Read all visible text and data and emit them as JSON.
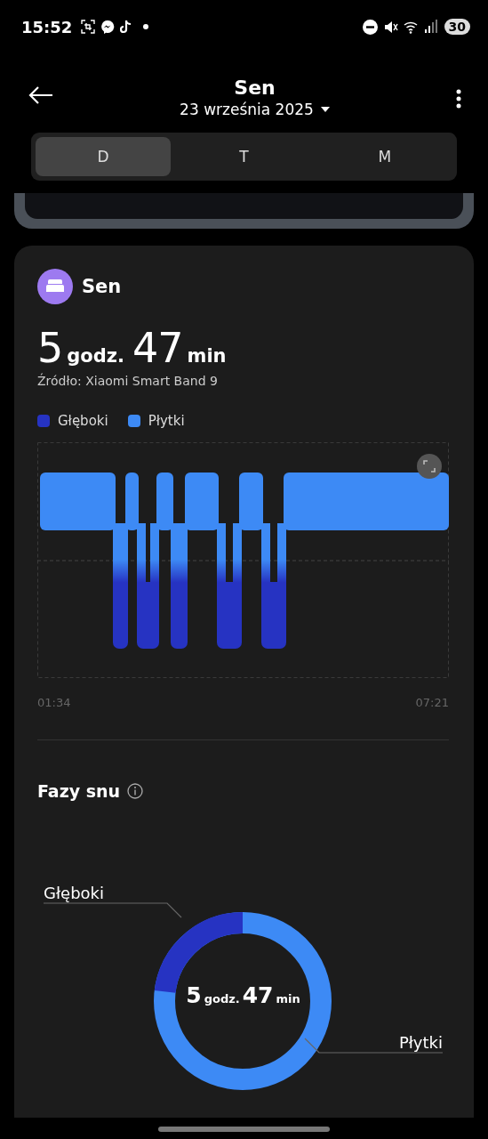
{
  "status_bar": {
    "time": "15:52",
    "battery": "30"
  },
  "header": {
    "title": "Sen",
    "date": "23 września 2025"
  },
  "tabs": [
    {
      "label": "D",
      "selected": true
    },
    {
      "label": "T",
      "selected": false
    },
    {
      "label": "M",
      "selected": false
    }
  ],
  "card": {
    "title": "Sen",
    "duration": {
      "hours": "5",
      "hours_unit": "godz.",
      "minutes": "47",
      "minutes_unit": "min"
    },
    "source": "Źródło: Xiaomi Smart Band 9",
    "legend": [
      {
        "label": "Głęboki",
        "color": "#2633c2"
      },
      {
        "label": "Płytki",
        "color": "#3d8af5"
      }
    ],
    "start_time": "01:34",
    "end_time": "07:21"
  },
  "phases": {
    "title": "Fazy snu",
    "labels": [
      "Głęboki",
      "Płytki"
    ],
    "center": {
      "hours": "5",
      "hours_unit": "godz.",
      "minutes": "47",
      "minutes_unit": "min"
    }
  }
}
